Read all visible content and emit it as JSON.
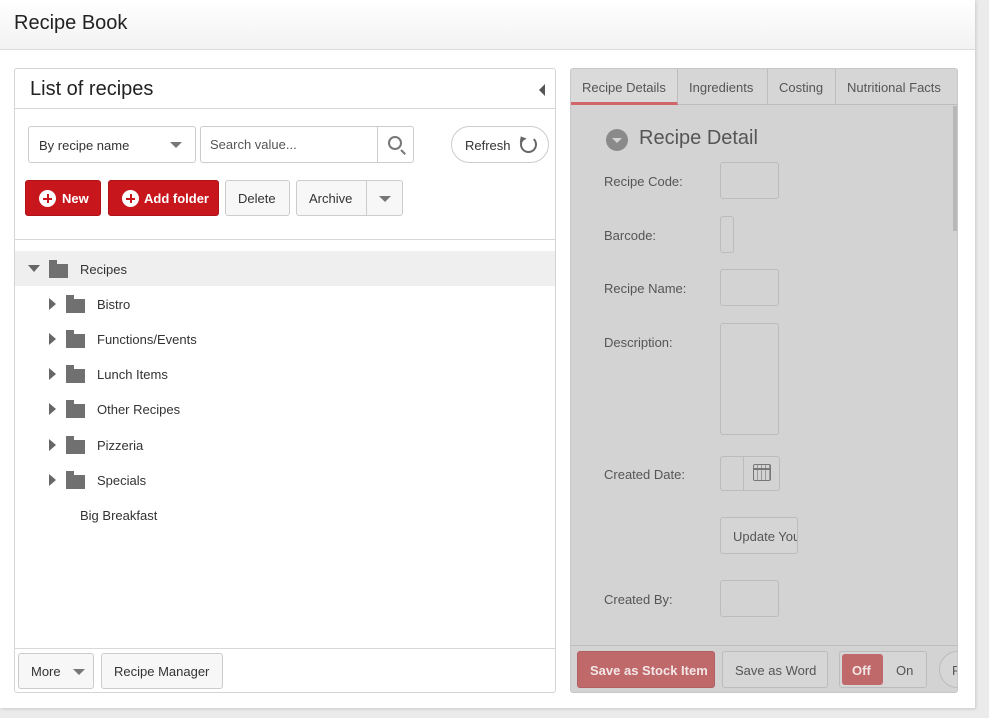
{
  "app": {
    "title": "Recipe Book"
  },
  "list_panel": {
    "title": "List of recipes",
    "filter": {
      "selected": "By recipe name"
    },
    "search": {
      "placeholder": "Search value..."
    },
    "refresh_label": "Refresh",
    "new_label": "New",
    "add_folder_label": "Add folder",
    "delete_label": "Delete",
    "archive_label": "Archive",
    "tree": {
      "root": "Recipes",
      "folders": [
        "Bistro",
        "Functions/Events",
        "Lunch Items",
        "Other Recipes",
        "Pizzeria",
        "Specials"
      ],
      "items": [
        "Big Breakfast"
      ]
    },
    "footer": {
      "more_label": "More",
      "recipe_manager_label": "Recipe Manager"
    }
  },
  "detail_panel": {
    "tabs": [
      "Recipe Details",
      "Ingredients",
      "Costing",
      "Nutritional Facts"
    ],
    "active_tab": "Recipe Details",
    "section_title": "Recipe Detail",
    "fields": {
      "recipe_code": "Recipe Code:",
      "barcode": "Barcode:",
      "recipe_name": "Recipe Name:",
      "description": "Description:",
      "created_date": "Created Date:",
      "created_by": "Created By:"
    },
    "update_button_label": "Update You",
    "footer": {
      "save_stock_label": "Save as Stock Item",
      "save_word_label": "Save as Word",
      "toggle_off_label": "Off",
      "toggle_on_label": "On",
      "toggle_state": "Off",
      "partial_button_label": "F"
    }
  },
  "colors": {
    "brand_red": "#c8161d",
    "disabled_red": "#c0696b",
    "panel_gray": "#d3d3d3"
  }
}
